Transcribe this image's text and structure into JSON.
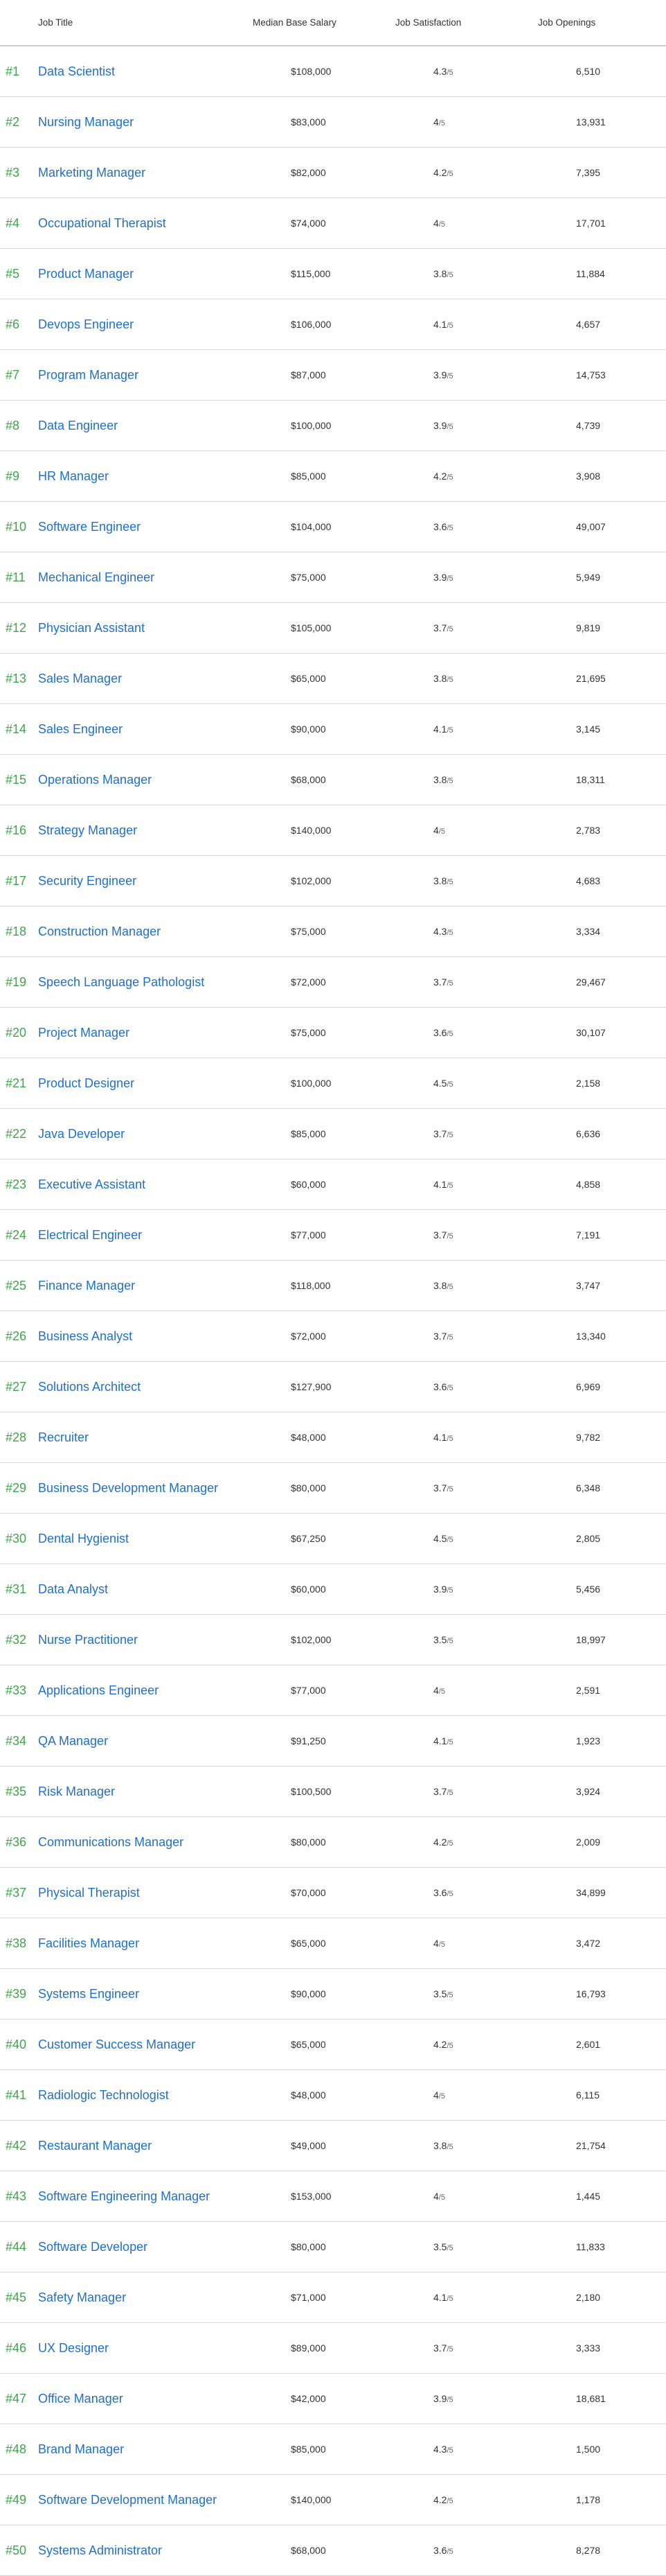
{
  "header": {
    "job_title": "Job Title",
    "median_base_salary": "Median Base Salary",
    "job_satisfaction": "Job Satisfaction",
    "job_openings": "Job Openings"
  },
  "sat_denominator": "/5",
  "jobs": [
    {
      "rank": "#1",
      "title": "Data Scientist",
      "salary": "$108,000",
      "satisfaction": "4.3",
      "openings": "6,510"
    },
    {
      "rank": "#2",
      "title": "Nursing Manager",
      "salary": "$83,000",
      "satisfaction": "4",
      "openings": "13,931"
    },
    {
      "rank": "#3",
      "title": "Marketing Manager",
      "salary": "$82,000",
      "satisfaction": "4.2",
      "openings": "7,395"
    },
    {
      "rank": "#4",
      "title": "Occupational Therapist",
      "salary": "$74,000",
      "satisfaction": "4",
      "openings": "17,701"
    },
    {
      "rank": "#5",
      "title": "Product Manager",
      "salary": "$115,000",
      "satisfaction": "3.8",
      "openings": "11,884"
    },
    {
      "rank": "#6",
      "title": "Devops Engineer",
      "salary": "$106,000",
      "satisfaction": "4.1",
      "openings": "4,657"
    },
    {
      "rank": "#7",
      "title": "Program Manager",
      "salary": "$87,000",
      "satisfaction": "3.9",
      "openings": "14,753"
    },
    {
      "rank": "#8",
      "title": "Data Engineer",
      "salary": "$100,000",
      "satisfaction": "3.9",
      "openings": "4,739"
    },
    {
      "rank": "#9",
      "title": "HR Manager",
      "salary": "$85,000",
      "satisfaction": "4.2",
      "openings": "3,908"
    },
    {
      "rank": "#10",
      "title": "Software Engineer",
      "salary": "$104,000",
      "satisfaction": "3.6",
      "openings": "49,007"
    },
    {
      "rank": "#11",
      "title": "Mechanical Engineer",
      "salary": "$75,000",
      "satisfaction": "3.9",
      "openings": "5,949"
    },
    {
      "rank": "#12",
      "title": "Physician Assistant",
      "salary": "$105,000",
      "satisfaction": "3.7",
      "openings": "9,819"
    },
    {
      "rank": "#13",
      "title": "Sales Manager",
      "salary": "$65,000",
      "satisfaction": "3.8",
      "openings": "21,695"
    },
    {
      "rank": "#14",
      "title": "Sales Engineer",
      "salary": "$90,000",
      "satisfaction": "4.1",
      "openings": "3,145"
    },
    {
      "rank": "#15",
      "title": "Operations Manager",
      "salary": "$68,000",
      "satisfaction": "3.8",
      "openings": "18,311"
    },
    {
      "rank": "#16",
      "title": "Strategy Manager",
      "salary": "$140,000",
      "satisfaction": "4",
      "openings": "2,783"
    },
    {
      "rank": "#17",
      "title": "Security Engineer",
      "salary": "$102,000",
      "satisfaction": "3.8",
      "openings": "4,683"
    },
    {
      "rank": "#18",
      "title": "Construction Manager",
      "salary": "$75,000",
      "satisfaction": "4.3",
      "openings": "3,334"
    },
    {
      "rank": "#19",
      "title": "Speech Language Pathologist",
      "salary": "$72,000",
      "satisfaction": "3.7",
      "openings": "29,467"
    },
    {
      "rank": "#20",
      "title": "Project Manager",
      "salary": "$75,000",
      "satisfaction": "3.6",
      "openings": "30,107"
    },
    {
      "rank": "#21",
      "title": "Product Designer",
      "salary": "$100,000",
      "satisfaction": "4.5",
      "openings": "2,158"
    },
    {
      "rank": "#22",
      "title": "Java Developer",
      "salary": "$85,000",
      "satisfaction": "3.7",
      "openings": "6,636"
    },
    {
      "rank": "#23",
      "title": "Executive Assistant",
      "salary": "$60,000",
      "satisfaction": "4.1",
      "openings": "4,858"
    },
    {
      "rank": "#24",
      "title": "Electrical Engineer",
      "salary": "$77,000",
      "satisfaction": "3.7",
      "openings": "7,191"
    },
    {
      "rank": "#25",
      "title": "Finance Manager",
      "salary": "$118,000",
      "satisfaction": "3.8",
      "openings": "3,747"
    },
    {
      "rank": "#26",
      "title": "Business Analyst",
      "salary": "$72,000",
      "satisfaction": "3.7",
      "openings": "13,340"
    },
    {
      "rank": "#27",
      "title": "Solutions Architect",
      "salary": "$127,900",
      "satisfaction": "3.6",
      "openings": "6,969"
    },
    {
      "rank": "#28",
      "title": "Recruiter",
      "salary": "$48,000",
      "satisfaction": "4.1",
      "openings": "9,782"
    },
    {
      "rank": "#29",
      "title": "Business Development Manager",
      "salary": "$80,000",
      "satisfaction": "3.7",
      "openings": "6,348"
    },
    {
      "rank": "#30",
      "title": "Dental Hygienist",
      "salary": "$67,250",
      "satisfaction": "4.5",
      "openings": "2,805"
    },
    {
      "rank": "#31",
      "title": "Data Analyst",
      "salary": "$60,000",
      "satisfaction": "3.9",
      "openings": "5,456"
    },
    {
      "rank": "#32",
      "title": "Nurse Practitioner",
      "salary": "$102,000",
      "satisfaction": "3.5",
      "openings": "18,997"
    },
    {
      "rank": "#33",
      "title": "Applications Engineer",
      "salary": "$77,000",
      "satisfaction": "4",
      "openings": "2,591"
    },
    {
      "rank": "#34",
      "title": "QA Manager",
      "salary": "$91,250",
      "satisfaction": "4.1",
      "openings": "1,923"
    },
    {
      "rank": "#35",
      "title": "Risk Manager",
      "salary": "$100,500",
      "satisfaction": "3.7",
      "openings": "3,924"
    },
    {
      "rank": "#36",
      "title": "Communications Manager",
      "salary": "$80,000",
      "satisfaction": "4.2",
      "openings": "2,009"
    },
    {
      "rank": "#37",
      "title": "Physical Therapist",
      "salary": "$70,000",
      "satisfaction": "3.6",
      "openings": "34,899"
    },
    {
      "rank": "#38",
      "title": "Facilities Manager",
      "salary": "$65,000",
      "satisfaction": "4",
      "openings": "3,472"
    },
    {
      "rank": "#39",
      "title": "Systems Engineer",
      "salary": "$90,000",
      "satisfaction": "3.5",
      "openings": "16,793"
    },
    {
      "rank": "#40",
      "title": "Customer Success Manager",
      "salary": "$65,000",
      "satisfaction": "4.2",
      "openings": "2,601"
    },
    {
      "rank": "#41",
      "title": "Radiologic Technologist",
      "salary": "$48,000",
      "satisfaction": "4",
      "openings": "6,115"
    },
    {
      "rank": "#42",
      "title": "Restaurant Manager",
      "salary": "$49,000",
      "satisfaction": "3.8",
      "openings": "21,754"
    },
    {
      "rank": "#43",
      "title": "Software Engineering Manager",
      "salary": "$153,000",
      "satisfaction": "4",
      "openings": "1,445"
    },
    {
      "rank": "#44",
      "title": "Software Developer",
      "salary": "$80,000",
      "satisfaction": "3.5",
      "openings": "11,833"
    },
    {
      "rank": "#45",
      "title": "Safety Manager",
      "salary": "$71,000",
      "satisfaction": "4.1",
      "openings": "2,180"
    },
    {
      "rank": "#46",
      "title": "UX Designer",
      "salary": "$89,000",
      "satisfaction": "3.7",
      "openings": "3,333"
    },
    {
      "rank": "#47",
      "title": "Office Manager",
      "salary": "$42,000",
      "satisfaction": "3.9",
      "openings": "18,681"
    },
    {
      "rank": "#48",
      "title": "Brand Manager",
      "salary": "$85,000",
      "satisfaction": "4.3",
      "openings": "1,500"
    },
    {
      "rank": "#49",
      "title": "Software Development Manager",
      "salary": "$140,000",
      "satisfaction": "4.2",
      "openings": "1,178"
    },
    {
      "rank": "#50",
      "title": "Systems Administrator",
      "salary": "$68,000",
      "satisfaction": "3.6",
      "openings": "8,278"
    }
  ]
}
